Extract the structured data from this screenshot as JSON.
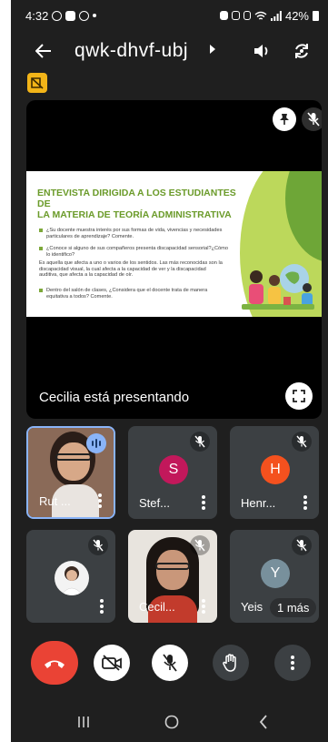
{
  "status_bar": {
    "time": "4:32",
    "battery": "42%"
  },
  "header": {
    "meeting_code": "qwk-dhvf-ubj"
  },
  "presentation": {
    "presenter_text": "Cecilia está presentando",
    "slide": {
      "title_line1": "ENTEVISTA DIRIGIDA A LOS ESTUDIANTES DE",
      "title_line2": "LA MATERIA DE TEORÍA ADMINISTRATIVA",
      "item1_line1": "¿Su docente muestra interés por sus formas de vida, vivencias y necesidades",
      "item1_line2": "particulares de aprendizaje? Comente.",
      "item2_line1": "¿Conoce si alguno de sus compañeros presenta discapacidad sensorial?¿Cómo",
      "item2_line2": "lo identifico?",
      "para_line1": "Es aquella que afecta a uno o varios de los sentidos. Las más reconocidas son la",
      "para_line2": "discapacidad visual, la cual afecta a la capacidad de ver y la discapacidad",
      "para_line3": "auditiva, que afecta a la capacidad de oír.",
      "item3_line1": "Dentro del salón de clases, ¿Considera que el docente trata de manera",
      "item3_line2": "equitativa a todos? Comente."
    }
  },
  "participants": [
    {
      "name": "Rut ...",
      "initial": "",
      "speaking": true
    },
    {
      "name": "Stef...",
      "initial": "S",
      "avatar_color": "#c2185b"
    },
    {
      "name": "Henr...",
      "initial": "H",
      "avatar_color": "#f4511e"
    },
    {
      "name": "",
      "initial": ""
    },
    {
      "name": "Cecil...",
      "initial": ""
    },
    {
      "name": "Yeis",
      "initial": "Y",
      "avatar_color": "#78909c",
      "more_label": "1 más"
    }
  ],
  "colors": {
    "end_call": "#ea4335",
    "speaking": "#8ab4f8",
    "warning": "#f2b418",
    "slide_green": "#6b9b2a"
  },
  "icons": [
    "back-arrow-icon",
    "chevron-right-icon",
    "speaker-icon",
    "camera-flip-icon",
    "warning-icon",
    "pin-icon",
    "mic-off-icon",
    "fullscreen-icon",
    "end-call-icon",
    "camera-off-icon",
    "hand-raise-icon",
    "more-icon"
  ]
}
